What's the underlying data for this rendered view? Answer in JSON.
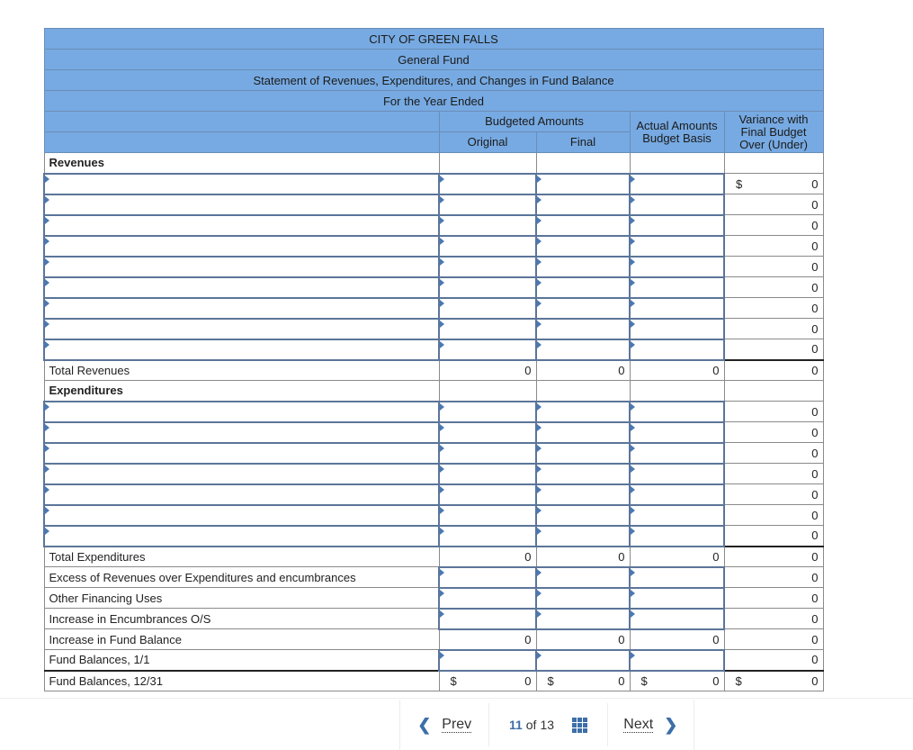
{
  "header": {
    "entity": "CITY OF GREEN FALLS",
    "fund": "General Fund",
    "statement": "Statement of Revenues, Expenditures, and Changes in Fund Balance",
    "period": "For the Year Ended"
  },
  "columns": {
    "budgeted_amounts": "Budgeted Amounts",
    "original": "Original",
    "final": "Final",
    "actual": "Actual Amounts Budget Basis",
    "variance": "Variance with Final Budget Over (Under)"
  },
  "revenues": {
    "label": "Revenues",
    "rows": [
      {
        "label": "",
        "original": "",
        "final": "",
        "actual": "",
        "variance": "0",
        "dollar": "$"
      },
      {
        "label": "",
        "original": "",
        "final": "",
        "actual": "",
        "variance": "0"
      },
      {
        "label": "",
        "original": "",
        "final": "",
        "actual": "",
        "variance": "0"
      },
      {
        "label": "",
        "original": "",
        "final": "",
        "actual": "",
        "variance": "0"
      },
      {
        "label": "",
        "original": "",
        "final": "",
        "actual": "",
        "variance": "0"
      },
      {
        "label": "",
        "original": "",
        "final": "",
        "actual": "",
        "variance": "0"
      },
      {
        "label": "",
        "original": "",
        "final": "",
        "actual": "",
        "variance": "0"
      },
      {
        "label": "",
        "original": "",
        "final": "",
        "actual": "",
        "variance": "0"
      },
      {
        "label": "",
        "original": "",
        "final": "",
        "actual": "",
        "variance": "0"
      }
    ],
    "total": {
      "label": "Total Revenues",
      "original": "0",
      "final": "0",
      "actual": "0",
      "variance": "0"
    }
  },
  "expenditures": {
    "label": "Expenditures",
    "rows": [
      {
        "label": "",
        "original": "",
        "final": "",
        "actual": "",
        "variance": "0"
      },
      {
        "label": "",
        "original": "",
        "final": "",
        "actual": "",
        "variance": "0"
      },
      {
        "label": "",
        "original": "",
        "final": "",
        "actual": "",
        "variance": "0"
      },
      {
        "label": "",
        "original": "",
        "final": "",
        "actual": "",
        "variance": "0"
      },
      {
        "label": "",
        "original": "",
        "final": "",
        "actual": "",
        "variance": "0"
      },
      {
        "label": "",
        "original": "",
        "final": "",
        "actual": "",
        "variance": "0"
      },
      {
        "label": "",
        "original": "",
        "final": "",
        "actual": "",
        "variance": "0"
      }
    ],
    "total": {
      "label": "Total Expenditures",
      "original": "0",
      "final": "0",
      "actual": "0",
      "variance": "0"
    }
  },
  "summary": {
    "excess": {
      "label": "Excess of Revenues over Expenditures and encumbrances",
      "variance": "0"
    },
    "other_financing": {
      "label": "Other Financing Uses",
      "variance": "0"
    },
    "encumbrances": {
      "label": "Increase in Encumbrances O/S",
      "variance": "0"
    },
    "increase_fund": {
      "label": "Increase in Fund Balance",
      "original": "0",
      "final": "0",
      "actual": "0",
      "variance": "0"
    },
    "fund_begin": {
      "label": "Fund Balances, 1/1",
      "variance": "0"
    },
    "fund_end": {
      "label": "Fund Balances, 12/31",
      "dollar": "$",
      "original": "0",
      "final": "0",
      "actual": "0",
      "variance": "0"
    }
  },
  "pager": {
    "prev": "Prev",
    "current": "11",
    "of": "of",
    "total": "13",
    "next": "Next"
  }
}
